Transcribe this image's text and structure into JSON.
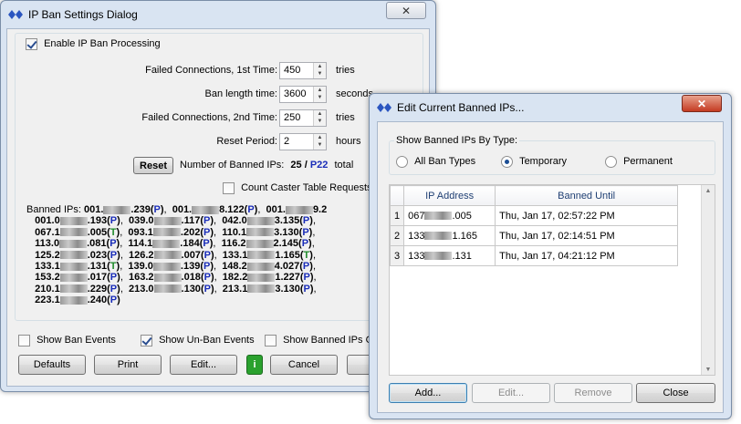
{
  "main": {
    "title": "IP Ban Settings Dialog",
    "close_label": "✕",
    "enable_label": "Enable IP Ban Processing",
    "fields": [
      {
        "label": "Failed Connections, 1st Time:",
        "value": "450",
        "unit": "tries"
      },
      {
        "label": "Ban length time:",
        "value": "3600",
        "unit": "seconds"
      },
      {
        "label": "Failed Connections, 2nd Time:",
        "value": "250",
        "unit": "tries"
      },
      {
        "label": "Reset Period:",
        "value": "2",
        "unit": "hours"
      }
    ],
    "reset_label": "Reset",
    "count_label": "Number of Banned IPs:",
    "count_value": "25",
    "count_sep": " / ",
    "count_p": "P22",
    "count_total": "total",
    "caster_label": "Count Caster Table Requests",
    "banned_prefix": "Banned IPs:",
    "banned_lines": [
      [
        {
          "a": "001.",
          "b": ".239",
          "t": "P"
        },
        {
          "a": "001.",
          "b": "8.122",
          "t": "P"
        },
        {
          "a": "001.",
          "b": "9.2",
          "t": ""
        }
      ],
      [
        {
          "a": "001.0",
          "b": ".193",
          "t": "P"
        },
        {
          "a": "039.0",
          "b": ".117",
          "t": "P"
        },
        {
          "a": "042.0",
          "b": "3.135",
          "t": "P"
        }
      ],
      [
        {
          "a": "067.1",
          "b": ".005",
          "t": "T"
        },
        {
          "a": "093.1",
          "b": ".202",
          "t": "P"
        },
        {
          "a": "110.1",
          "b": "3.130",
          "t": "P"
        }
      ],
      [
        {
          "a": "113.0",
          "b": ".081",
          "t": "P"
        },
        {
          "a": "114.1",
          "b": ".184",
          "t": "P"
        },
        {
          "a": "116.2",
          "b": "2.145",
          "t": "P"
        }
      ],
      [
        {
          "a": "125.2",
          "b": ".023",
          "t": "P"
        },
        {
          "a": "126.2",
          "b": ".007",
          "t": "P"
        },
        {
          "a": "133.1",
          "b": "1.165",
          "t": "T"
        }
      ],
      [
        {
          "a": "133.1",
          "b": ".131",
          "t": "T"
        },
        {
          "a": "139.0",
          "b": ".139",
          "t": "P"
        },
        {
          "a": "148.2",
          "b": "4.027",
          "t": "P"
        }
      ],
      [
        {
          "a": "153.2",
          "b": ".017",
          "t": "P"
        },
        {
          "a": "163.2",
          "b": ".018",
          "t": "P"
        },
        {
          "a": "182.2",
          "b": "1.227",
          "t": "P"
        }
      ],
      [
        {
          "a": "210.1",
          "b": ".229",
          "t": "P"
        },
        {
          "a": "213.0",
          "b": ".130",
          "t": "P"
        },
        {
          "a": "213.1",
          "b": "3.130",
          "t": "P"
        }
      ],
      [
        {
          "a": "223.1",
          "b": ".240",
          "t": "P"
        }
      ]
    ],
    "show_ban_events": "Show Ban Events",
    "show_unban_events": "Show Un-Ban Events",
    "show_banned_ips": "Show Banned IPs Co",
    "buttons": {
      "defaults": "Defaults",
      "print": "Print",
      "edit": "Edit...",
      "info": "i",
      "cancel": "Cancel"
    }
  },
  "edit": {
    "title": "Edit Current Banned IPs...",
    "close_label": "✕",
    "group_label": "Show Banned IPs By Type:",
    "radios": [
      {
        "label": "All Ban Types",
        "checked": false
      },
      {
        "label": "Temporary",
        "checked": true
      },
      {
        "label": "Permanent",
        "checked": false
      }
    ],
    "columns": [
      "IP Address",
      "Banned Until"
    ],
    "rows": [
      {
        "n": "1",
        "ip_a": "067",
        "ip_b": ".005",
        "until": "Thu, Jan 17, 02:57:22 PM"
      },
      {
        "n": "2",
        "ip_a": "133",
        "ip_b": "1.165",
        "until": "Thu, Jan 17, 02:14:51 PM"
      },
      {
        "n": "3",
        "ip_a": "133",
        "ip_b": ".131",
        "until": "Thu, Jan 17, 04:21:12 PM"
      }
    ],
    "buttons": {
      "add": "Add...",
      "edit": "Edit...",
      "remove": "Remove",
      "close": "Close"
    }
  }
}
